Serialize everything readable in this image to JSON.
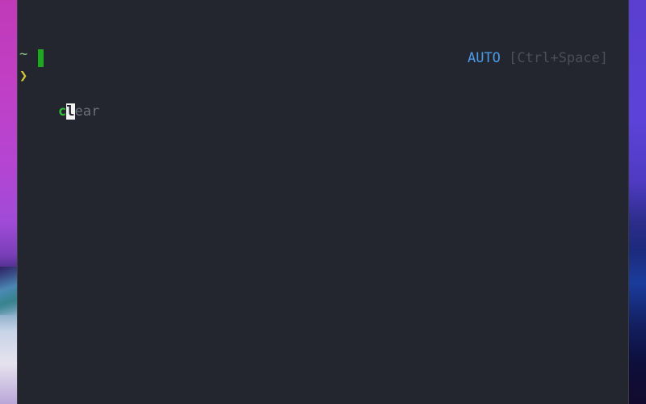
{
  "terminal": {
    "cwd": "~",
    "prompt_symbol": "❯",
    "command": {
      "typed": "c",
      "cursor_char": "l",
      "suggestion": "ear"
    },
    "mode": {
      "label": "AUTO",
      "hint": "[Ctrl+Space]"
    }
  },
  "colors": {
    "terminal_bg": "#23262e",
    "cwd": "#8fbf8f",
    "prompt": "#d4c83a",
    "typed": "#2fbf3a",
    "suggestion": "#6b6f78",
    "mode_label": "#4a9be8",
    "mode_hint": "#4a4e57"
  }
}
